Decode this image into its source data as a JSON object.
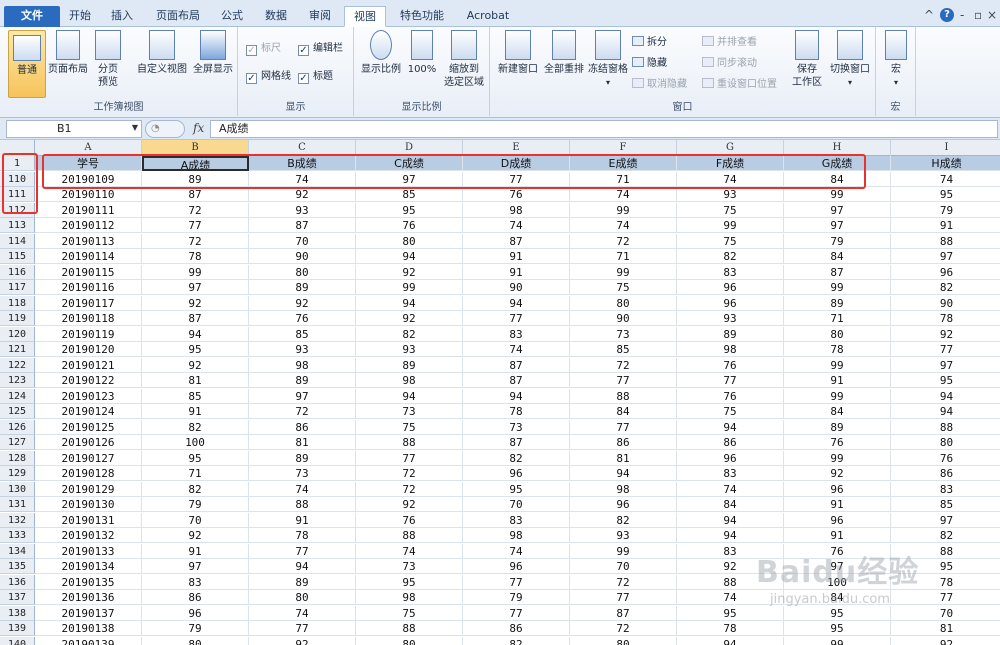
{
  "ribbon_tabs": [
    {
      "label": "文件",
      "type": "file"
    },
    {
      "label": "开始"
    },
    {
      "label": "插入"
    },
    {
      "label": "页面布局"
    },
    {
      "label": "公式"
    },
    {
      "label": "数据"
    },
    {
      "label": "审阅"
    },
    {
      "label": "视图",
      "active": true
    },
    {
      "label": "特色功能"
    },
    {
      "label": "Acrobat"
    }
  ],
  "window_controls": [
    "^",
    "?",
    "-",
    "▫",
    "×"
  ],
  "groups": {
    "workbook_views": {
      "title": "工作簿视图",
      "normal": "普通",
      "page_layout": "页面布局",
      "page_break_1": "分页",
      "page_break_2": "预览",
      "custom_view": "自定义视图",
      "full_screen": "全屏显示"
    },
    "show": {
      "title": "显示",
      "ruler": "标尺",
      "formula_bar": "编辑栏",
      "gridlines": "网格线",
      "headings": "标题"
    },
    "zoom": {
      "title": "显示比例",
      "zoom": "显示比例",
      "zoom100": "100%",
      "zoom_sel_1": "缩放到",
      "zoom_sel_2": "选定区域"
    },
    "window": {
      "title": "窗口",
      "new_window": "新建窗口",
      "arrange_all": "全部重排",
      "freeze_panes": "冻结窗格",
      "split": "拆分",
      "hide": "隐藏",
      "unhide": "取消隐藏",
      "side_by_side": "并排查看",
      "sync_scroll": "同步滚动",
      "reset_pos": "重设窗口位置",
      "save_ws_1": "保存",
      "save_ws_2": "工作区",
      "switch_win": "切换窗口"
    },
    "macros": {
      "title": "宏",
      "macros": "宏"
    }
  },
  "formula_bar": {
    "name_box": "B1",
    "fx": "fx",
    "content": "A成绩"
  },
  "columns": [
    "A",
    "B",
    "C",
    "D",
    "E",
    "F",
    "G",
    "H",
    "I"
  ],
  "header_row": {
    "num": "1",
    "cells": [
      "学号",
      "A成绩",
      "B成绩",
      "C成绩",
      "D成绩",
      "E成绩",
      "F成绩",
      "G成绩",
      "H成绩"
    ]
  },
  "rows": [
    [
      "110",
      "20190109",
      "89",
      "74",
      "97",
      "77",
      "71",
      "74",
      "84",
      "74"
    ],
    [
      "111",
      "20190110",
      "87",
      "92",
      "85",
      "76",
      "74",
      "93",
      "99",
      "95"
    ],
    [
      "112",
      "20190111",
      "72",
      "93",
      "95",
      "98",
      "99",
      "75",
      "97",
      "79"
    ],
    [
      "113",
      "20190112",
      "77",
      "87",
      "76",
      "74",
      "74",
      "99",
      "97",
      "91"
    ],
    [
      "114",
      "20190113",
      "72",
      "70",
      "80",
      "87",
      "72",
      "75",
      "79",
      "88"
    ],
    [
      "115",
      "20190114",
      "78",
      "90",
      "94",
      "91",
      "71",
      "82",
      "84",
      "97"
    ],
    [
      "116",
      "20190115",
      "99",
      "80",
      "92",
      "91",
      "99",
      "83",
      "87",
      "96"
    ],
    [
      "117",
      "20190116",
      "97",
      "89",
      "99",
      "90",
      "75",
      "96",
      "99",
      "82"
    ],
    [
      "118",
      "20190117",
      "92",
      "92",
      "94",
      "94",
      "80",
      "96",
      "89",
      "90"
    ],
    [
      "119",
      "20190118",
      "87",
      "76",
      "92",
      "77",
      "90",
      "93",
      "71",
      "78"
    ],
    [
      "120",
      "20190119",
      "94",
      "85",
      "82",
      "83",
      "73",
      "89",
      "80",
      "92"
    ],
    [
      "121",
      "20190120",
      "95",
      "93",
      "93",
      "74",
      "85",
      "98",
      "78",
      "77"
    ],
    [
      "122",
      "20190121",
      "92",
      "98",
      "89",
      "87",
      "72",
      "76",
      "99",
      "97"
    ],
    [
      "123",
      "20190122",
      "81",
      "89",
      "98",
      "87",
      "77",
      "77",
      "91",
      "95"
    ],
    [
      "124",
      "20190123",
      "85",
      "97",
      "94",
      "94",
      "88",
      "76",
      "99",
      "94"
    ],
    [
      "125",
      "20190124",
      "91",
      "72",
      "73",
      "78",
      "84",
      "75",
      "84",
      "94"
    ],
    [
      "126",
      "20190125",
      "82",
      "86",
      "75",
      "73",
      "77",
      "94",
      "89",
      "88"
    ],
    [
      "127",
      "20190126",
      "100",
      "81",
      "88",
      "87",
      "86",
      "86",
      "76",
      "80"
    ],
    [
      "128",
      "20190127",
      "95",
      "89",
      "77",
      "82",
      "81",
      "96",
      "99",
      "76"
    ],
    [
      "129",
      "20190128",
      "71",
      "73",
      "72",
      "96",
      "94",
      "83",
      "92",
      "86"
    ],
    [
      "130",
      "20190129",
      "82",
      "74",
      "72",
      "95",
      "98",
      "74",
      "96",
      "83"
    ],
    [
      "131",
      "20190130",
      "79",
      "88",
      "92",
      "70",
      "96",
      "84",
      "91",
      "85"
    ],
    [
      "132",
      "20190131",
      "70",
      "91",
      "76",
      "83",
      "82",
      "94",
      "96",
      "97"
    ],
    [
      "133",
      "20190132",
      "92",
      "78",
      "88",
      "98",
      "93",
      "94",
      "91",
      "82"
    ],
    [
      "134",
      "20190133",
      "91",
      "77",
      "74",
      "74",
      "99",
      "83",
      "76",
      "88"
    ],
    [
      "135",
      "20190134",
      "97",
      "94",
      "73",
      "96",
      "70",
      "92",
      "97",
      "95"
    ],
    [
      "136",
      "20190135",
      "83",
      "89",
      "95",
      "77",
      "72",
      "88",
      "100",
      "78"
    ],
    [
      "137",
      "20190136",
      "86",
      "80",
      "98",
      "79",
      "77",
      "74",
      "84",
      "77"
    ],
    [
      "138",
      "20190137",
      "96",
      "74",
      "75",
      "77",
      "87",
      "95",
      "95",
      "70"
    ],
    [
      "139",
      "20190138",
      "79",
      "77",
      "88",
      "86",
      "72",
      "78",
      "95",
      "81"
    ],
    [
      "140",
      "20190139",
      "80",
      "92",
      "80",
      "82",
      "80",
      "94",
      "99",
      "92"
    ]
  ],
  "watermark": {
    "main": "Baidu经验",
    "sub": "jingyan.baidu.com"
  }
}
